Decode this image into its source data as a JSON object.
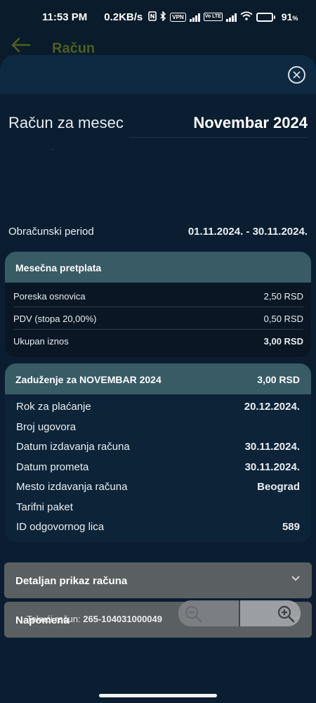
{
  "status_bar": {
    "time": "11:53 PM",
    "net_speed": "0.2KB/s",
    "vpn": "VPN",
    "volte": "Vo LTE",
    "battery_percent": "91",
    "battery_suffix": "%"
  },
  "header": {
    "title": "Račun"
  },
  "bill": {
    "month_label": "Račun za mesec",
    "month_value": "Novembar 2024",
    "period_label": "Obračunski period",
    "period_value": "01.11.2024. - 30.11.2024."
  },
  "subscription": {
    "title": "Mesečna pretplata",
    "rows": [
      {
        "label": "Poreska osnovica",
        "value": "2,50 RSD"
      },
      {
        "label": "PDV (stopa 20,00%)",
        "value": "0,50 RSD"
      },
      {
        "label": "Ukupan iznos",
        "value": "3,00 RSD"
      }
    ]
  },
  "charge": {
    "title": "Zaduženje za NOVEMBAR 2024",
    "amount": "3,00 RSD",
    "rows": [
      {
        "label": "Rok za plaćanje",
        "value": "20.12.2024."
      },
      {
        "label": "Broj ugovora",
        "value": ""
      },
      {
        "label": "Datum izdavanja računa",
        "value": "30.11.2024."
      },
      {
        "label": "Datum prometa",
        "value": "30.11.2024."
      },
      {
        "label": "Mesto izdavanja računa",
        "value": "Beograd"
      },
      {
        "label": "Tarifni paket",
        "value": ""
      },
      {
        "label": "ID odgovornog lica",
        "value": "589"
      }
    ]
  },
  "accordions": [
    {
      "label": "Detaljan prikaz računa"
    },
    {
      "label": "Napomena"
    }
  ],
  "footer": {
    "account_label": "Tekući račun:",
    "account_value": "265-104031000049"
  },
  "colors": {
    "background": "#0a1b2b",
    "card_header": "#385b66",
    "accordion": "#5a5f61",
    "header_title": "#4d5f1f"
  }
}
